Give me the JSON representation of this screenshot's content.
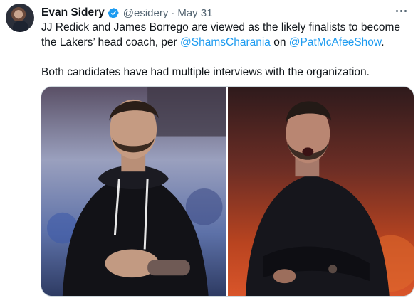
{
  "tweet": {
    "author": {
      "name": "Evan Sidery",
      "handle": "@esidery",
      "separator": "·",
      "date": "May 31",
      "verified": true,
      "verified_color": "#1d9bf0"
    },
    "text": {
      "line1_before": "JJ Redick and James Borrego are viewed as the likely finalists to become the Lakers’ head coach, per ",
      "mention1": "@ShamsCharania",
      "line1_middle": " on ",
      "mention2": "@PatMcAfeeShow",
      "line1_after": ".",
      "paragraph2": "Both candidates have had multiple interviews with the organization."
    },
    "media": {
      "photos": [
        {
          "subject": "man in black hoodie, hands clasped, arena background"
        },
        {
          "subject": "man in black jacket, arms crossed, shouting, orange background"
        }
      ]
    },
    "icons": {
      "more": "more-options-icon",
      "verified": "verified-badge-icon"
    },
    "colors": {
      "text": "#0f1419",
      "secondary": "#536471",
      "link": "#1d9bf0"
    }
  }
}
